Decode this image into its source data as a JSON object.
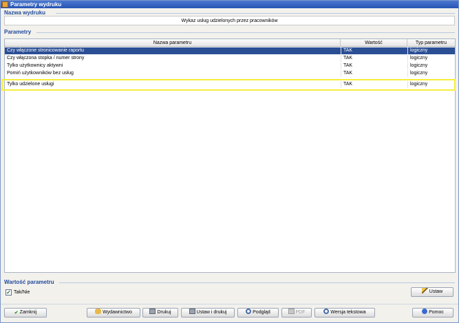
{
  "window": {
    "title": "Parametry wydruku"
  },
  "report": {
    "section_label": "Nazwa wydruku",
    "name": "Wykaz usług udzielonych przez pracowników"
  },
  "params": {
    "section_label": "Parametry",
    "columns": [
      "Nazwa parametru",
      "Wartość",
      "Typ parametru"
    ],
    "rows": [
      {
        "name": "Czy włączone stronicowanie raportu",
        "value": "TAK",
        "type": "logiczny"
      },
      {
        "name": "Czy włączona stopka / numer strony",
        "value": "TAK",
        "type": "logiczny"
      },
      {
        "name": "Tylko użytkownicy aktywni",
        "value": "TAK",
        "type": "logiczny"
      },
      {
        "name": "Pomiń użytkowników bez usług",
        "value": "TAK",
        "type": "logiczny"
      },
      {
        "name": "Tylko udzielone usługi",
        "value": "TAK",
        "type": "logiczny"
      }
    ]
  },
  "value_section": {
    "section_label": "Wartość parametru",
    "checkbox_label": "Tak/Nie",
    "checked": true
  },
  "buttons": {
    "ustaw": "Ustaw",
    "zamknij": "Zamknij",
    "wydawnictwo": "Wydawnictwo",
    "drukuj": "Drukuj",
    "ustaw_i_drukuj": "Ustaw i drukuj",
    "podglad": "Podgląd",
    "pdf": "PDF",
    "wersja_tekstowa": "Wersja tekstowa",
    "pomoc": "Pomoc"
  },
  "colors": {
    "selection": "#2b4f95",
    "highlight": "#f5ee3a",
    "section_label": "#214a9c"
  }
}
